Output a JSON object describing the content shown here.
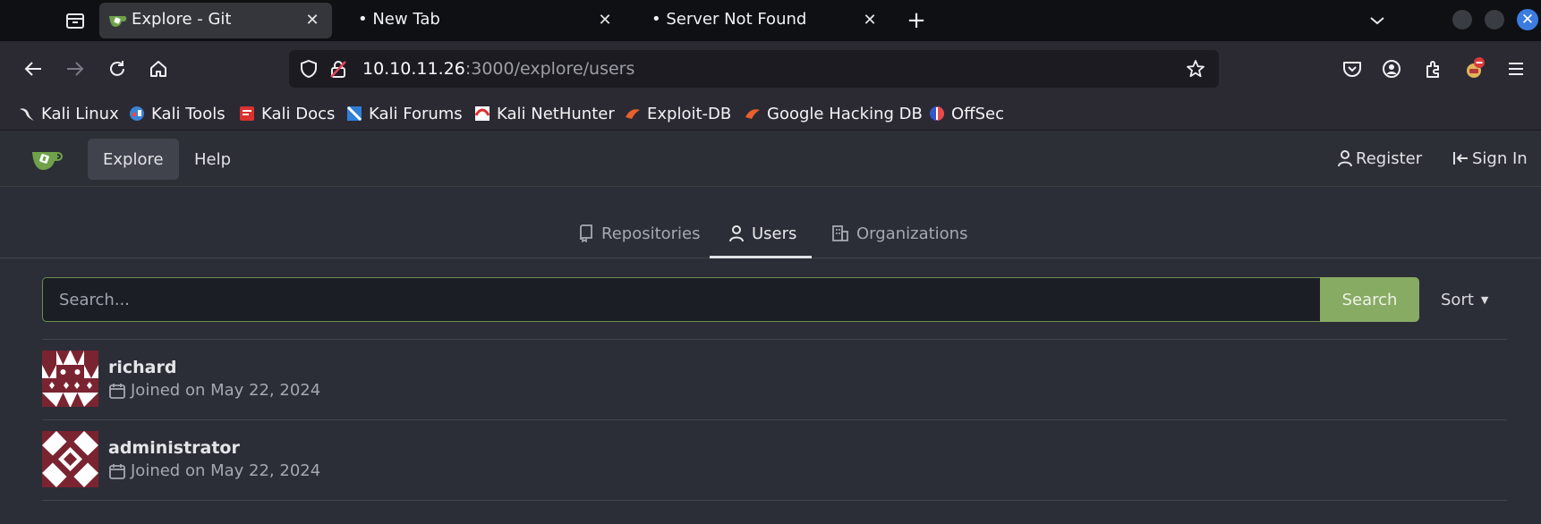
{
  "browser": {
    "tabs": [
      {
        "title": "Explore - Git",
        "active": true
      },
      {
        "title": "New Tab",
        "active": false
      },
      {
        "title": "Server Not Found",
        "active": false
      }
    ],
    "new_tab_symbol": "+",
    "url": {
      "host": "10.10.11.26",
      "rest": ":3000/explore/users"
    },
    "bookmarks": [
      {
        "label": "Kali Linux",
        "icon": "kali-dragon-icon"
      },
      {
        "label": "Kali Tools",
        "icon": "kali-tools-icon"
      },
      {
        "label": "Kali Docs",
        "icon": "kali-docs-icon"
      },
      {
        "label": "Kali Forums",
        "icon": "kali-forums-icon"
      },
      {
        "label": "Kali NetHunter",
        "icon": "kali-nethunter-icon"
      },
      {
        "label": "Exploit-DB",
        "icon": "exploit-db-icon"
      },
      {
        "label": "Google Hacking DB",
        "icon": "ghdb-icon"
      },
      {
        "label": "OffSec",
        "icon": "offsec-icon"
      }
    ]
  },
  "gitea": {
    "nav": {
      "explore": "Explore",
      "help": "Help"
    },
    "auth": {
      "register": "Register",
      "sign_in": "Sign In"
    },
    "subnav": {
      "repositories": "Repositories",
      "users": "Users",
      "organizations": "Organizations"
    },
    "search": {
      "placeholder": "Search...",
      "button": "Search",
      "sort": "Sort"
    },
    "users": [
      {
        "name": "richard",
        "joined": "Joined on May 22, 2024"
      },
      {
        "name": "administrator",
        "joined": "Joined on May 22, 2024"
      }
    ],
    "colors": {
      "accent": "#87ab63",
      "avatar": "#7a2432"
    }
  }
}
